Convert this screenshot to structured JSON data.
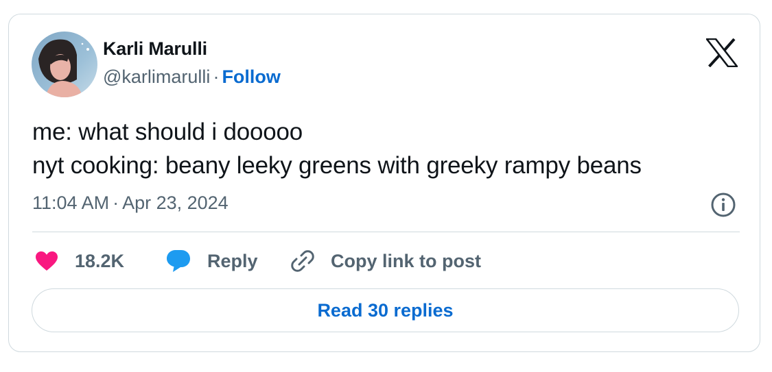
{
  "author": {
    "display_name": "Karli Marulli",
    "handle": "@karlimarulli",
    "separator": "·",
    "follow_label": "Follow",
    "avatar_icon": "profile-photo"
  },
  "tweet": {
    "lines": [
      "me: what should i dooooo",
      "nyt cooking: beany leeky greens with greeky rampy beans"
    ],
    "time": "11:04 AM",
    "date_separator": "·",
    "date": "Apr 23, 2024"
  },
  "actions": {
    "likes_count": "18.2K",
    "reply_label": "Reply",
    "copy_link_label": "Copy link to post"
  },
  "read_replies_label": "Read 30 replies",
  "icons": {
    "brand": "x-logo-icon",
    "info": "info-icon",
    "like": "heart-icon",
    "reply": "speech-bubble-icon",
    "copy": "link-icon"
  },
  "colors": {
    "text_primary": "#0f1419",
    "text_secondary": "#536471",
    "link_blue": "#0a6bd0",
    "like_pink": "#f91880",
    "reply_blue": "#1d9bf0",
    "border": "#cfd9de"
  }
}
